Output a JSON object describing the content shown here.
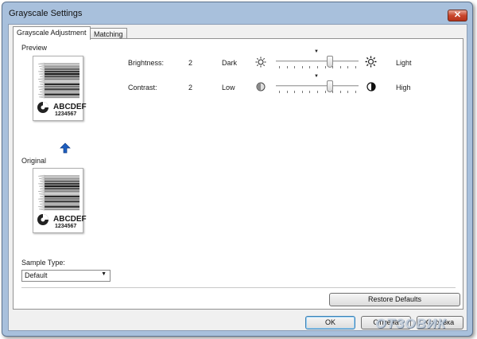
{
  "window": {
    "title": "Grayscale Settings",
    "close_glyph": "✕"
  },
  "tabs": [
    {
      "label": "Grayscale Adjustment",
      "active": true
    },
    {
      "label": "Matching",
      "active": false
    }
  ],
  "preview": {
    "label": "Preview",
    "text1": "ABCDEF",
    "text2": "1234567"
  },
  "original": {
    "label": "Original",
    "text1": "ABCDEF",
    "text2": "1234567"
  },
  "brightness": {
    "label": "Brightness:",
    "value": "2",
    "low_label": "Dark",
    "high_label": "Light",
    "low_icon": "sun-dim-icon",
    "high_icon": "sun-bright-icon",
    "level": 0.67
  },
  "contrast": {
    "label": "Contrast:",
    "value": "2",
    "low_label": "Low",
    "high_label": "High",
    "low_icon": "contrast-low-icon",
    "high_icon": "contrast-high-icon",
    "level": 0.67
  },
  "sample_type": {
    "label": "Sample Type:",
    "value": "Default"
  },
  "buttons": {
    "restore_defaults": "Restore Defaults",
    "ok": "OK",
    "cancel": "Отмена",
    "help": "Справка"
  },
  "watermark": "ОТЗОВИК",
  "colors": {
    "title_bar": "#a8c0dc",
    "close_red": "#c9462c",
    "arrow_blue": "#1e5fc1"
  }
}
